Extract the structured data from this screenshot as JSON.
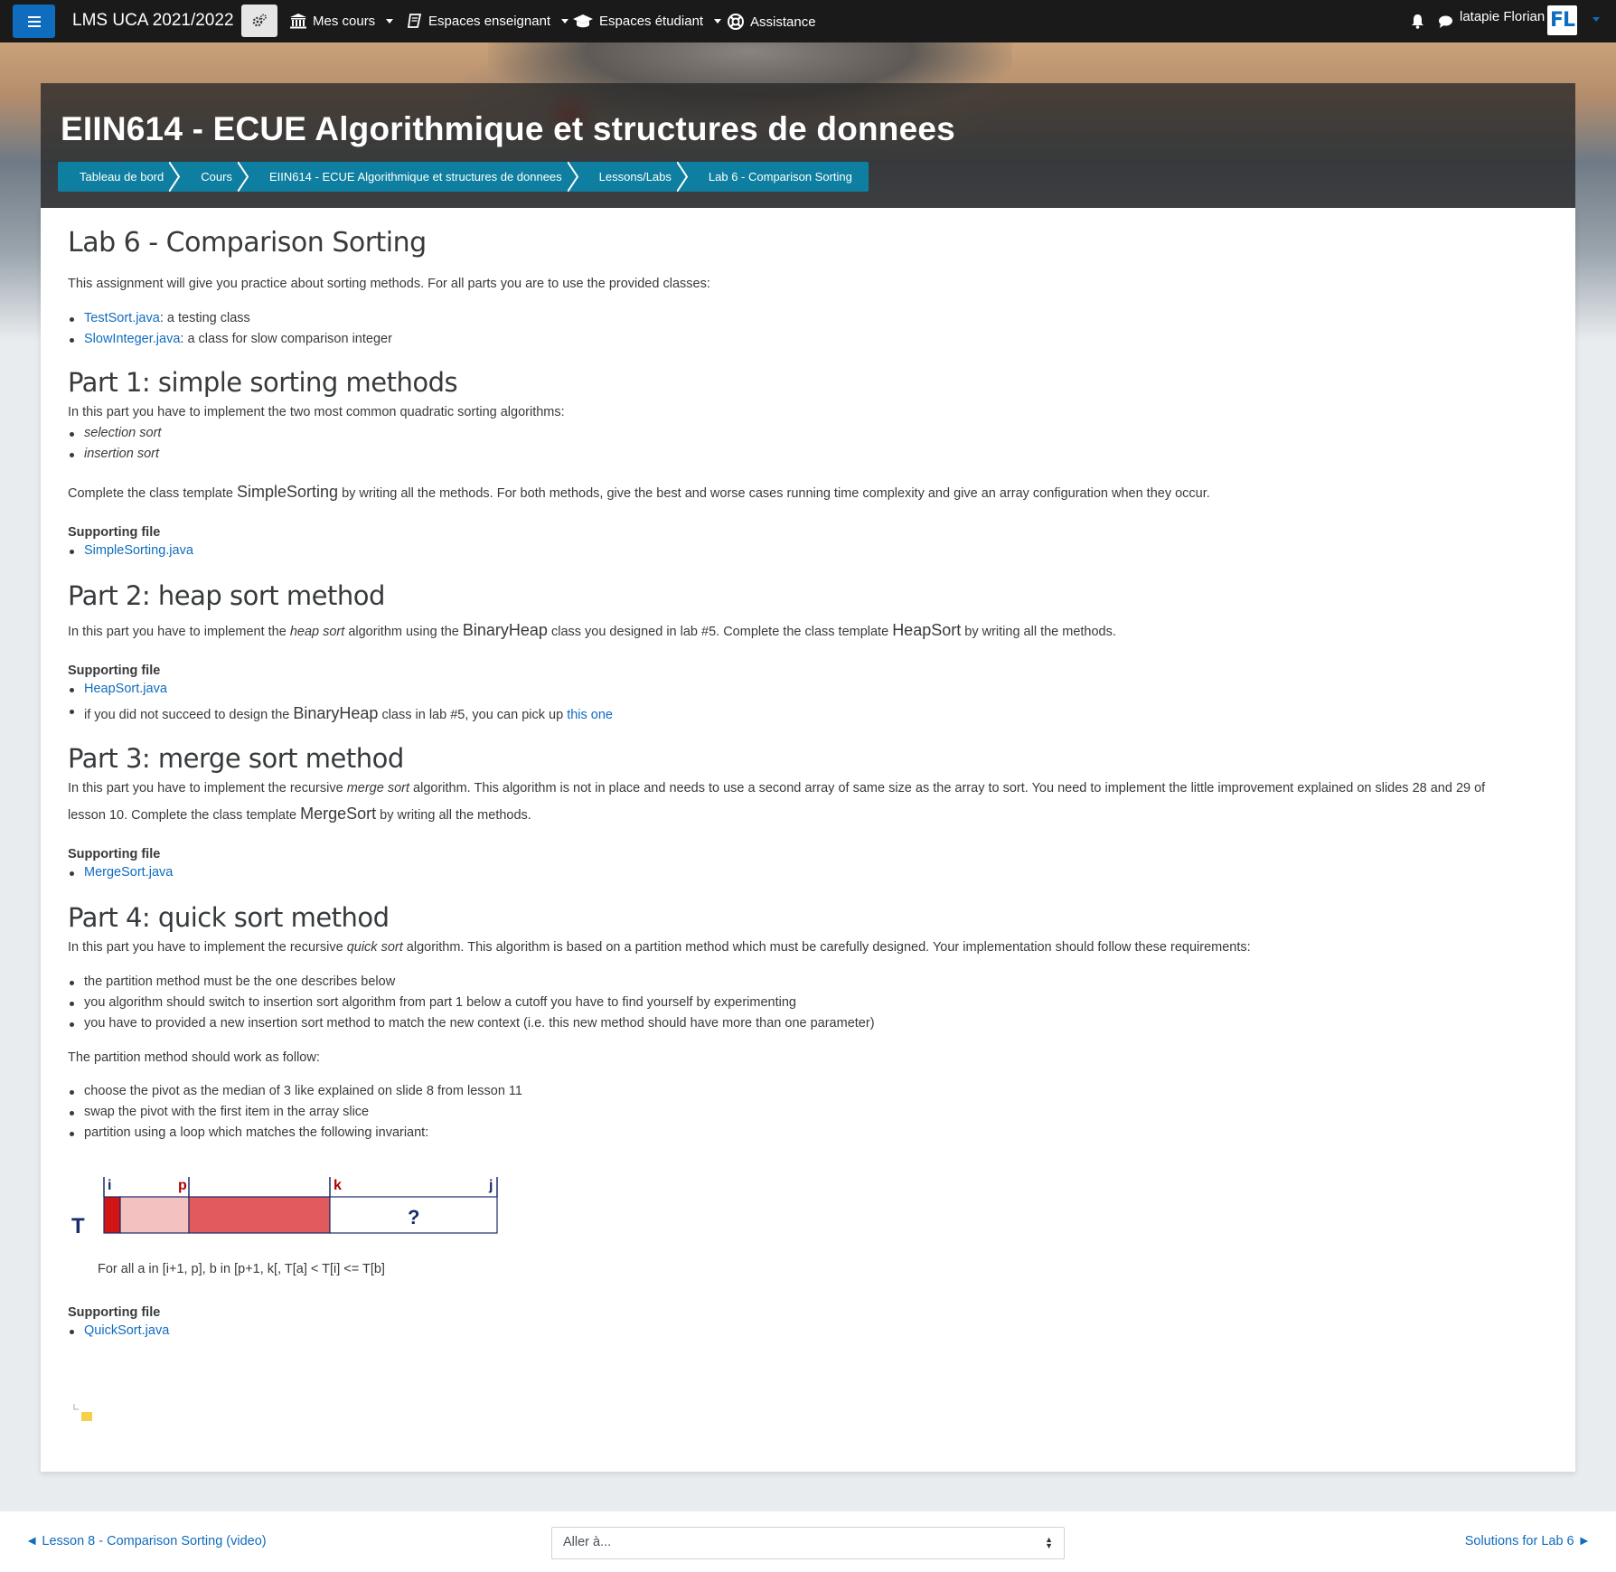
{
  "navbar": {
    "brand": "LMS UCA 2021/2022",
    "menus": [
      "Mes cours",
      "Espaces enseignant",
      "Espaces étudiant",
      "Assistance"
    ],
    "user_name": "latapie Florian",
    "avatar_initials": "FL",
    "accent_color": "#0f6cbf"
  },
  "header": {
    "title": "EIIN614 - ECUE Algorithmique et structures de donnees",
    "breadcrumb": [
      "Tableau de bord",
      "Cours",
      "EIIN614 - ECUE Algorithmique et structures de donnees",
      "Lessons/Labs",
      "Lab 6 - Comparison Sorting"
    ]
  },
  "content": {
    "title": "Lab 6 - Comparison Sorting",
    "intro": "This assignment will give you practice about  sorting methods. For all parts you are to use the provided classes:",
    "provided": [
      {
        "link": "TestSort.java",
        "text": ": a testing class"
      },
      {
        "link": "SlowInteger.java",
        "text": ": a  class for slow comparison integer"
      }
    ],
    "supporting_label": "Supporting file",
    "part1": {
      "title": "Part 1: simple sorting methods",
      "intro": "In this part you have to implement the two most common quadratic sorting algorithms:",
      "items": [
        "selection sort",
        "insertion sort"
      ],
      "body_pre": "Complete the class template ",
      "body_class": "SimpleSorting",
      "body_post": " by writing all the methods. For both methods, give the best and worse cases running time complexity and give an array configuration when they occur.",
      "file": "SimpleSorting.java"
    },
    "part2": {
      "title": "Part 2: heap sort method",
      "t1": "In this part you have to implement the ",
      "t2": "heap sort",
      "t3": " algorithm using the ",
      "t4": "BinaryHeap",
      "t5": " class you designed in lab #5. Complete the class template ",
      "t6": "HeapSort",
      "t7": " by writing all the methods.",
      "file": "HeapSort.java",
      "note_pre": "if you did not succeed to design the ",
      "note_class": "BinaryHeap",
      "note_mid": " class in lab #5, you can pick up ",
      "note_link": "this one"
    },
    "part3": {
      "title": "Part 3: merge sort method",
      "t1": "In this part you have to implement the recursive ",
      "t2": "merge sort",
      "t3": " algorithm. This algorithm is not in place and needs to use a second array of same size as the array to sort. You need to implement the little improvement explained on slides 28 and 29 of",
      "t4": "lesson 10. Complete the class template ",
      "t5": "MergeSort",
      "t6": " by writing all the methods.",
      "file": "MergeSort.java"
    },
    "part4": {
      "title": "Part 4: quick sort method",
      "t1": "In this part you have to implement the recursive ",
      "t2": "quick sort",
      "t3": " algorithm. This algorithm is based on a partition method which must be carefully designed. Your implementation should follow these requirements:",
      "requirements": [
        "the partition method must be the one describes below",
        "you algorithm should switch to insertion sort algorithm from part 1 below a cutoff you have to find yourself by experimenting",
        "you have to provided a new insertion sort method to match the new context (i.e. this new method should have more than one parameter)"
      ],
      "partition_intro": "The partition method should work as follow:",
      "partition_steps": [
        "choose the pivot as the median of 3 like explained on slide 8 from lesson 11",
        "swap the pivot with the first item in the array slice",
        "partition using a loop which matches the following invariant:"
      ],
      "diagram": {
        "array_label": "T",
        "markers": [
          "i",
          "p",
          "k",
          "j"
        ],
        "unknown": "?"
      },
      "invariant": "For all a in [i+1, p],  b in [p+1, k[,    T[a] < T[i] <= T[b]",
      "file": "QuickSort.java"
    }
  },
  "footer": {
    "prev": "◄ Lesson 8 - Comparison Sorting (video)",
    "jump_placeholder": "Aller à...",
    "next": "Solutions for Lab 6 ►"
  }
}
